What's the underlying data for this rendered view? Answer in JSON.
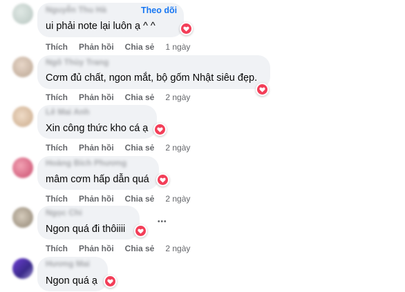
{
  "actions": {
    "like": "Thích",
    "reply": "Phản hồi",
    "share": "Chia sẻ"
  },
  "follow_label": "Theo dõi",
  "more_label": "•••",
  "comments": [
    {
      "author": "Nguyễn Thu Hà",
      "text": "ui phải note lại luôn ạ ^ ^",
      "time": "1 ngày",
      "reaction": "heart"
    },
    {
      "author": "Ngô Thùy Trang",
      "text": "Cơm đủ chất, ngon mắt, bộ gốm Nhật siêu đẹp.",
      "time": "2 ngày",
      "reaction": "heart"
    },
    {
      "author": "Lê Mai Anh",
      "text": "Xin công thức kho cá ạ",
      "time": "2 ngày",
      "reaction": "heart"
    },
    {
      "author": "Hoàng Bích Phương",
      "text": "mâm cơm hấp dẫn quá",
      "time": "2 ngày",
      "reaction": "heart"
    },
    {
      "author": "Ngọc Chi",
      "text": "Ngon quá đi thôiiii",
      "time": "2 ngày",
      "reaction": "heart"
    },
    {
      "author": "Hương Mai",
      "text": "Ngon quá ạ",
      "time": "",
      "reaction": "heart"
    }
  ],
  "colors": {
    "bubble": "#f0f2f5",
    "heart": "#f33e58",
    "link": "#1877f2",
    "secondary_text": "#65676b"
  }
}
